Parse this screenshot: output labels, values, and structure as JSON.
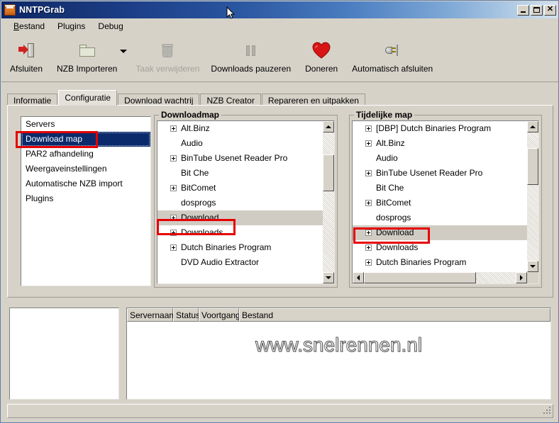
{
  "window": {
    "title": "NNTPGrab",
    "icon": "app-icon",
    "buttons": {
      "minimize": "–",
      "maximize": "□",
      "close": "✕"
    }
  },
  "menubar": {
    "items": [
      {
        "label": "Bestand",
        "accel": "B"
      },
      {
        "label": "Plugins",
        "accel": ""
      },
      {
        "label": "Debug",
        "accel": ""
      }
    ]
  },
  "toolbar": {
    "items": [
      {
        "label": "Afsluiten",
        "icon": "exit-icon",
        "disabled": false,
        "dropdown": false
      },
      {
        "label": "NZB Importeren",
        "icon": "folder-icon",
        "disabled": false,
        "dropdown": true
      },
      {
        "label": "Taak verwijderen",
        "icon": "trash-icon",
        "disabled": true,
        "dropdown": false
      },
      {
        "label": "Downloads pauzeren",
        "icon": "pause-icon",
        "disabled": false,
        "dropdown": false
      },
      {
        "label": "Doneren",
        "icon": "heart-icon",
        "disabled": false,
        "dropdown": false
      },
      {
        "label": "Automatisch afsluiten",
        "icon": "plug-icon",
        "disabled": false,
        "dropdown": false
      }
    ]
  },
  "tabs": [
    {
      "label": "Informatie",
      "active": false
    },
    {
      "label": "Configuratie",
      "active": true
    },
    {
      "label": "Download wachtrij",
      "active": false
    },
    {
      "label": "NZB Creator",
      "active": false
    },
    {
      "label": "Repareren en uitpakken",
      "active": false
    }
  ],
  "settings_list": {
    "items": [
      {
        "label": "Servers",
        "selected": false
      },
      {
        "label": "Download map",
        "selected": true
      },
      {
        "label": "PAR2 afhandeling",
        "selected": false
      },
      {
        "label": "Weergaveinstellingen",
        "selected": false
      },
      {
        "label": "Automatische NZB import",
        "selected": false
      },
      {
        "label": "Plugins",
        "selected": false
      }
    ]
  },
  "downloadmap": {
    "title": "Downloadmap",
    "nodes": [
      {
        "label": "Alt.Binz",
        "expandable": true,
        "selected": false
      },
      {
        "label": "Audio",
        "expandable": false,
        "selected": false
      },
      {
        "label": "BinTube Usenet Reader Pro",
        "expandable": true,
        "selected": false
      },
      {
        "label": "Bit Che",
        "expandable": false,
        "selected": false
      },
      {
        "label": "BitComet",
        "expandable": true,
        "selected": false
      },
      {
        "label": "dosprogs",
        "expandable": false,
        "selected": false
      },
      {
        "label": "Download",
        "expandable": true,
        "selected": true
      },
      {
        "label": "Downloads",
        "expandable": true,
        "selected": false
      },
      {
        "label": "Dutch Binaries Program",
        "expandable": true,
        "selected": false
      },
      {
        "label": "DVD Audio Extractor",
        "expandable": false,
        "selected": false
      }
    ]
  },
  "tijdelijkemap": {
    "title": "Tijdelijke map",
    "nodes": [
      {
        "label": "[DBP] Dutch Binaries Program",
        "expandable": true,
        "selected": false
      },
      {
        "label": "Alt.Binz",
        "expandable": true,
        "selected": false
      },
      {
        "label": "Audio",
        "expandable": false,
        "selected": false
      },
      {
        "label": "BinTube Usenet Reader Pro",
        "expandable": true,
        "selected": false
      },
      {
        "label": "Bit Che",
        "expandable": false,
        "selected": false
      },
      {
        "label": "BitComet",
        "expandable": true,
        "selected": false
      },
      {
        "label": "dosprogs",
        "expandable": false,
        "selected": false
      },
      {
        "label": "Download",
        "expandable": true,
        "selected": true
      },
      {
        "label": "Downloads",
        "expandable": true,
        "selected": false
      },
      {
        "label": "Dutch Binaries Program",
        "expandable": true,
        "selected": false
      }
    ]
  },
  "connection_list": {
    "columns": [
      "Servernaam",
      "Status",
      "Voortgang",
      "Bestand"
    ],
    "rows": [],
    "watermark": "www.snelrennen.nl"
  },
  "colors": {
    "highlight_box": "#e60000",
    "selection_blue": "#0b2a6b",
    "tree_selection": "#d0ccc4",
    "window_face": "#d6d2c8",
    "title_left": "#0a246a",
    "title_right": "#d4e2ef"
  }
}
